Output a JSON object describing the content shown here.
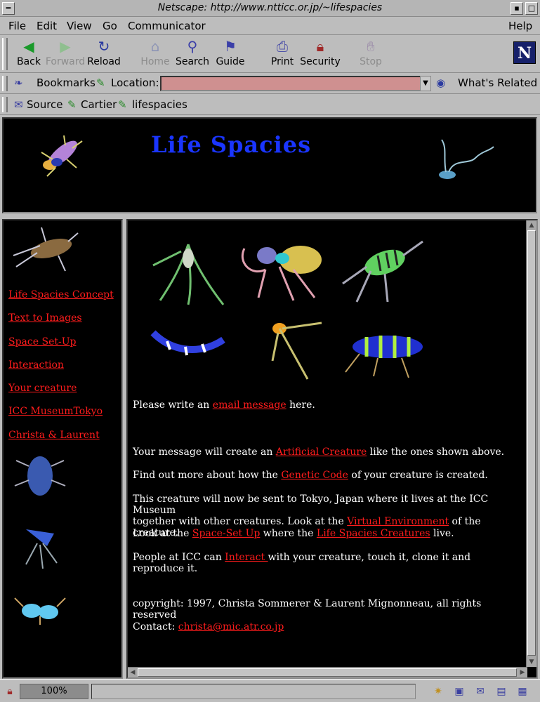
{
  "window": {
    "title": "Netscape: http://www.ntticc.or.jp/~lifespacies"
  },
  "menu": {
    "file": "File",
    "edit": "Edit",
    "view": "View",
    "go": "Go",
    "communicator": "Communicator",
    "help": "Help"
  },
  "toolbar": {
    "back": "Back",
    "forward": "Forward",
    "reload": "Reload",
    "home": "Home",
    "search": "Search",
    "guide": "Guide",
    "print": "Print",
    "security": "Security",
    "stop": "Stop"
  },
  "location": {
    "bookmarks": "Bookmarks",
    "label": "Location:",
    "value": "",
    "whats_related": "What's Related"
  },
  "personal": {
    "source": "Source",
    "cartier": "Cartier",
    "lifespacies": "lifespacies"
  },
  "banner": {
    "title": "Life Spacies"
  },
  "nav": {
    "links": [
      "Life Spacies Concept",
      "Text to Images",
      "Space Set-Up",
      "Interaction",
      "Your creature",
      "ICC MuseumTokyo",
      "Christa & Laurent"
    ]
  },
  "main": {
    "p1": {
      "before": "Please write an ",
      "link": "email message",
      "after": " here."
    },
    "p2": {
      "before": "Your message will create an ",
      "link": "Artificial Creature",
      "after": " like the ones shown above."
    },
    "p3": {
      "before": "Find out more about how the ",
      "link": "Genetic Code",
      "after": " of your creature is created."
    },
    "p4": {
      "line1": "This creature will now be sent to Tokyo, Japan where it lives at the ICC Museum",
      "line2_before": "together with other creatures. Look at the ",
      "link": "Virtual Environment",
      "after": " of the creature."
    },
    "p5": {
      "before": "Look at the ",
      "link1": "Space-Set Up",
      "middle": " where the ",
      "link2": "Life Spacies Creatures",
      "after": " live."
    },
    "p6": {
      "before": "People at ICC can ",
      "link": "Interact ",
      "after": "with your creature, touch it, clone it and reproduce it."
    },
    "copyright": "copyright: 1997, Christa Sommerer & Laurent Mignonneau, all rights reserved",
    "contact": {
      "label": "Contact: ",
      "email": "christa@mic.atr.co.jp"
    }
  },
  "status": {
    "zoom": "100%"
  }
}
